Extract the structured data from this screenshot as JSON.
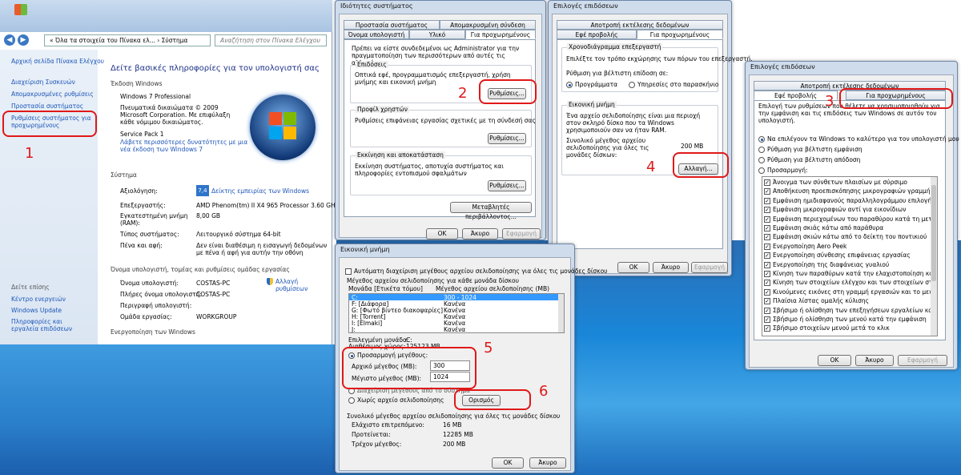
{
  "sysinfo": {
    "address": "« Όλα τα στοιχεία του Πίνακα ελ... › Σύστημα",
    "search_placeholder": "Αναζήτηση στον Πίνακα Ελέγχου",
    "home": "Αρχική σελίδα Πίνακα Ελέγχου",
    "side": [
      "Διαχείριση Συσκευών",
      "Απομακρυσμένες ρυθμίσεις",
      "Προστασία συστήματος",
      "Ρυθμίσεις συστήματος για προχωρημένους"
    ],
    "see_also": "Δείτε επίσης",
    "side2": [
      "Κέντρο ενεργειών",
      "Windows Update",
      "Πληροφορίες και εργαλεία επιδόσεων"
    ],
    "heading": "Δείτε βασικές πληροφορίες για τον υπολογιστή σας",
    "edition_h": "Έκδοση Windows",
    "edition": "Windows 7 Professional",
    "copyright": "Πνευματικά δικαιώματα © 2009 Microsoft Corporation. Με επιφύλαξη κάθε νόμιμου δικαιώματος.",
    "sp": "Service Pack 1",
    "sp_link": "Λάβετε περισσότερες δυνατότητες με μια νέα έκδοση των Windows 7",
    "system_h": "Σύστημα",
    "rows": [
      [
        "Αξιολόγηση:",
        "Δείκτης εμπειρίας των Windows"
      ],
      [
        "Επεξεργαστής:",
        "AMD Phenom(tm) II X4 965 Processor 3.60 GHz"
      ],
      [
        "Εγκατεστημένη μνήμη (RAM):",
        "8,00 GB"
      ],
      [
        "Τύπος συστήματος:",
        "Λειτουργικό σύστημα 64-bit"
      ],
      [
        "Πένα και αφή:",
        "Δεν είναι διαθέσιμη η εισαγωγή δεδομένων με πένα ή αφή για αυτήν την οθόνη"
      ]
    ],
    "wei": "7,4",
    "name_h": "Όνομα υπολογιστή, τομέας και ρυθμίσεις ομάδας εργασίας",
    "rows2": [
      [
        "Όνομα υπολογιστή:",
        "COSTAS-PC"
      ],
      [
        "Πλήρες όνομα υπολογιστή:",
        "COSTAS-PC"
      ],
      [
        "Περιγραφή υπολογιστή:",
        ""
      ],
      [
        "Ομάδα εργασίας:",
        "WORKGROUP"
      ]
    ],
    "change": "Αλλαγή ρυθμίσεων",
    "activation_h": "Ενεργοποίηση των Windows"
  },
  "sysprops": {
    "title": "Ιδιότητες συστήματος",
    "tabs": [
      "Προστασία συστήματος",
      "Απομακρυσμένη σύνδεση",
      "Όνομα υπολογιστή",
      "Υλικό",
      "Για προχωρημένους"
    ],
    "note": "Πρέπει να είστε συνδεδεμένοι ως Administrator για την πραγματοποίηση των περισσότερων από αυτές τις αλλαγές.",
    "g1": "Επιδόσεις",
    "g1t": "Οπτικά εφέ, προγραμματισμός επεξεργαστή, χρήση μνήμης και εικονική μνήμη",
    "g2": "Προφίλ χρηστών",
    "g2t": "Ρυθμίσεις επιφάνειας εργασίας σχετικές με τη σύνδεσή σας",
    "g3": "Εκκίνηση και αποκατάσταση",
    "g3t": "Εκκίνηση συστήματος, αποτυχία συστήματος και πληροφορίες εντοπισμού σφαλμάτων",
    "settings": "Ρυθμίσεις...",
    "env": "Μεταβλητές περιβάλλοντος...",
    "ok": "OK",
    "cancel": "Άκυρο",
    "apply": "Εφαρμογή"
  },
  "perf": {
    "title": "Επιλογές επιδόσεων",
    "tabs": [
      "Αποτροπή εκτέλεσης δεδομένων",
      "Εφέ προβολής",
      "Για προχωρημένους"
    ],
    "g1": "Χρονοδιάγραμμα επεξεργαστή",
    "g1t": "Επιλέξτε τον τρόπο εκχώρησης των πόρων του επεξεργαστή.",
    "adjust": "Ρύθμιση για βέλτιστη επίδοση σε:",
    "r1": "Προγράμματα",
    "r2": "Υπηρεσίες στο παρασκήνιο",
    "g2": "Εικονική μνήμη",
    "g2t": "Ένα αρχείο σελιδοποίησης είναι μια περιοχή στον σκληρό δίσκο που τα Windows χρησιμοποιούν σαν να ήταν RAM.",
    "total": "Συνολικό μέγεθος αρχείου σελιδοποίησης για όλες τις μονάδες δίσκων:",
    "total_v": "200 MB",
    "change": "Αλλαγή...",
    "ok": "OK",
    "cancel": "Άκυρο",
    "apply": "Εφαρμογή"
  },
  "vm": {
    "title": "Εικονική μνήμη",
    "auto": "Αυτόματη διαχείριση μεγέθους αρχείου σελιδοποίησης για όλες τις μονάδες δίσκου",
    "hdr": "Μέγεθος αρχείου σελιδοποίησης για κάθε μονάδα δίσκου",
    "col1": "Μονάδα [Ετικέτα τόμου]",
    "col2": "Μέγεθος αρχείου σελιδοποίησης (MB)",
    "drives": [
      [
        "C:",
        "300 - 1024"
      ],
      [
        "F:    [Διάφορα]",
        "Κανένα"
      ],
      [
        "G:    [Φωτό βίντεο διακοψαρίες]",
        "Κανένα"
      ],
      [
        "H:    [Torrent]",
        "Κανένα"
      ],
      [
        "I:    [Elmaki]",
        "Κανένα"
      ],
      [
        "J:",
        "Κανένα"
      ]
    ],
    "sel_l": "Επιλεγμένη μονάδα:",
    "sel_v": "C:",
    "free_l": "Διαθέσιμος χώρος:",
    "free_v": "125123 MB",
    "custom": "Προσαρμογή μεγέθους:",
    "init_l": "Αρχικό μέγεθος (MB):",
    "init_v": "300",
    "max_l": "Μέγιστο μέγεθος (MB):",
    "max_v": "1024",
    "sysman": "Διαχείριση μεγέθους από το σύστημα",
    "none": "Χωρίς αρχείο σελιδοποίησης",
    "set": "Ορισμός",
    "tot_h": "Συνολικό μέγεθος αρχείου σελιδοποίησης για όλες τις μονάδες δίσκου",
    "min_l": "Ελάχιστο επιτρεπόμενο:",
    "min_v": "16 MB",
    "rec_l": "Προτείνεται:",
    "rec_v": "12285 MB",
    "cur_l": "Τρέχον μέγεθος:",
    "cur_v": "200 MB",
    "ok": "OK",
    "cancel": "Άκυρο"
  },
  "vis": {
    "title": "Επιλογές επιδόσεων",
    "tabs": [
      "Αποτροπή εκτέλεσης δεδομένων",
      "Εφέ προβολής",
      "Για προχωρημένους"
    ],
    "intro": "Επιλογή των ρυθμίσεων που θέλετε να χρησιμοποιηθούν για την εμφάνιση και τις επιδόσεις των Windows σε αυτόν τον υπολογιστή.",
    "radios": [
      "Να επιλέγουν τα Windows το καλύτερο για τον υπολογιστή μου",
      "Ρύθμιση για βέλτιστη εμφάνιση",
      "Ρύθμιση για βέλτιστη απόδοση",
      "Προσαρμογή:"
    ],
    "items": [
      "Άνοιγμα των σύνθετων πλαισίων με σύρσιμο",
      "Αποθήκευση προεπισκόπησης μικρογραφιών γραμμής εργ",
      "Εμφάνιση ημιδιαφανούς παραλληλογράμμου επιλογής",
      "Εμφάνιση μικρογραφιών αντί για εικονίδιων",
      "Εμφάνιση περιεχομένων του παραθύρου κατά τη μεταφορ",
      "Εμφάνιση σκιάς κάτω από παράθυρα",
      "Εμφάνιση σκιών κάτω από το δείκτη του ποντικιού",
      "Ενεργοποίηση Aero Peek",
      "Ενεργοποίηση σύνθεσης επιφάνειας εργασίας",
      "Ενεργοποίηση της διαφάνειας γυαλιού",
      "Κίνηση των παραθύρων κατά την ελαχιστοποίηση και μεγι",
      "Κίνηση των στοιχείων ελέγχου και των στοιχείων στο παρά",
      "Κινούμενες εικόνες στη γραμμή εργασιών και το μενού Έ",
      "Πλαίσια λίστας ομαλής κύλισης",
      "Σβήσιμο ή ολίσθηση των επεξηγήσεων εργαλείων κατά την",
      "Σβήσιμο ή ολίσθηση των μενού κατά την εμφάνιση",
      "Σβήσιμο στοιχείων μενού μετά το κλικ"
    ],
    "ok": "OK",
    "cancel": "Άκυρο",
    "apply": "Εφαρμογή"
  },
  "numbers": [
    "1",
    "2",
    "3",
    "4",
    "5",
    "6"
  ]
}
